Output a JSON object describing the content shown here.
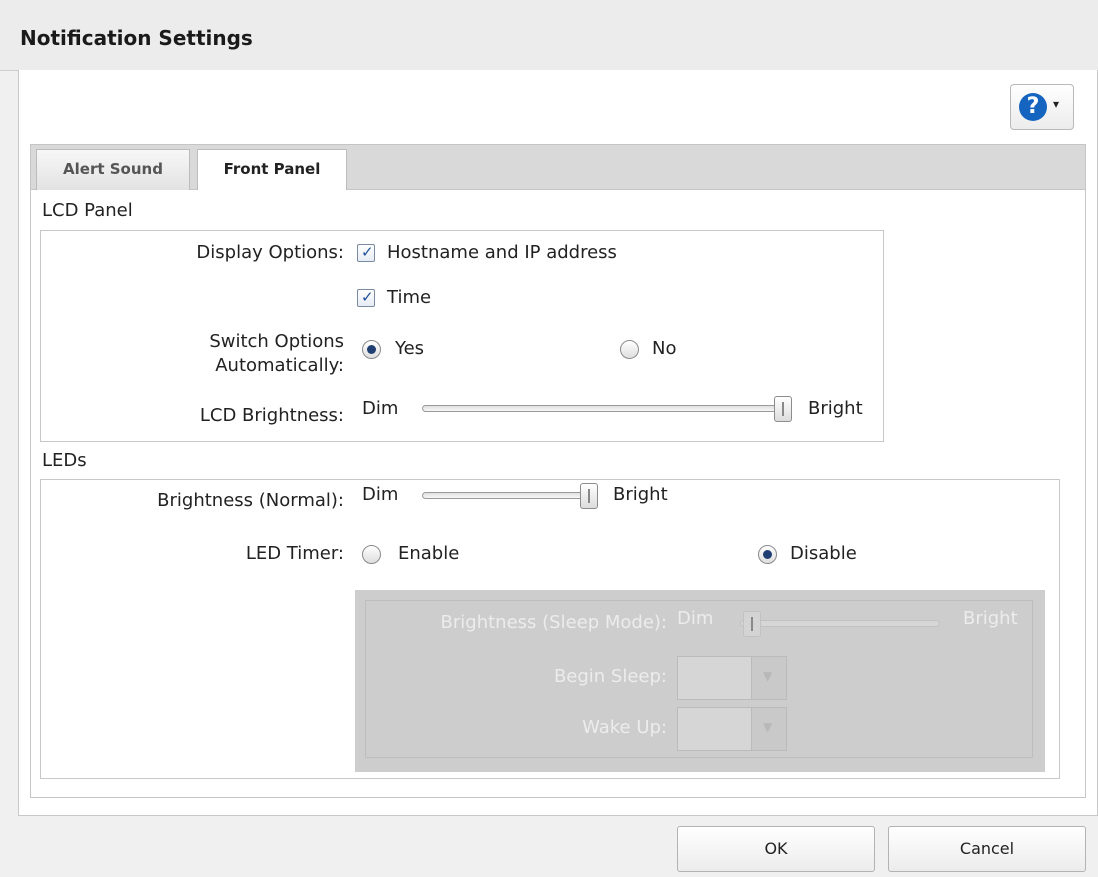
{
  "window": {
    "title": "Notification Settings"
  },
  "help": {
    "icon": "help-circle-icon",
    "glyph": "?",
    "caret": "▾"
  },
  "tabs": [
    {
      "label": "Alert Sound",
      "active": false
    },
    {
      "label": "Front Panel",
      "active": true
    }
  ],
  "lcd": {
    "section_title": "LCD Panel",
    "display_options_label": "Display Options:",
    "options": [
      {
        "label": "Hostname and IP address",
        "checked": true
      },
      {
        "label": "Time",
        "checked": true
      }
    ],
    "switch_label_line1": "Switch Options",
    "switch_label_line2": "Automatically:",
    "switch_yes": "Yes",
    "switch_no": "No",
    "switch_value": "Yes",
    "brightness_label": "LCD Brightness:",
    "brightness_min": "Dim",
    "brightness_max": "Bright",
    "brightness_level": 1.0
  },
  "leds": {
    "section_title": "LEDs",
    "brightness_label": "Brightness (Normal):",
    "brightness_min": "Dim",
    "brightness_max": "Bright",
    "brightness_level": 1.0,
    "timer_label": "LED Timer:",
    "timer_enable": "Enable",
    "timer_disable": "Disable",
    "timer_value": "Disable",
    "sleep_brightness_label": "Brightness (Sleep Mode):",
    "sleep_min": "Dim",
    "sleep_max": "Bright",
    "sleep_level": 0.0,
    "begin_sleep_label": "Begin Sleep:",
    "wake_up_label": "Wake Up:"
  },
  "footer": {
    "ok": "OK",
    "cancel": "Cancel"
  }
}
